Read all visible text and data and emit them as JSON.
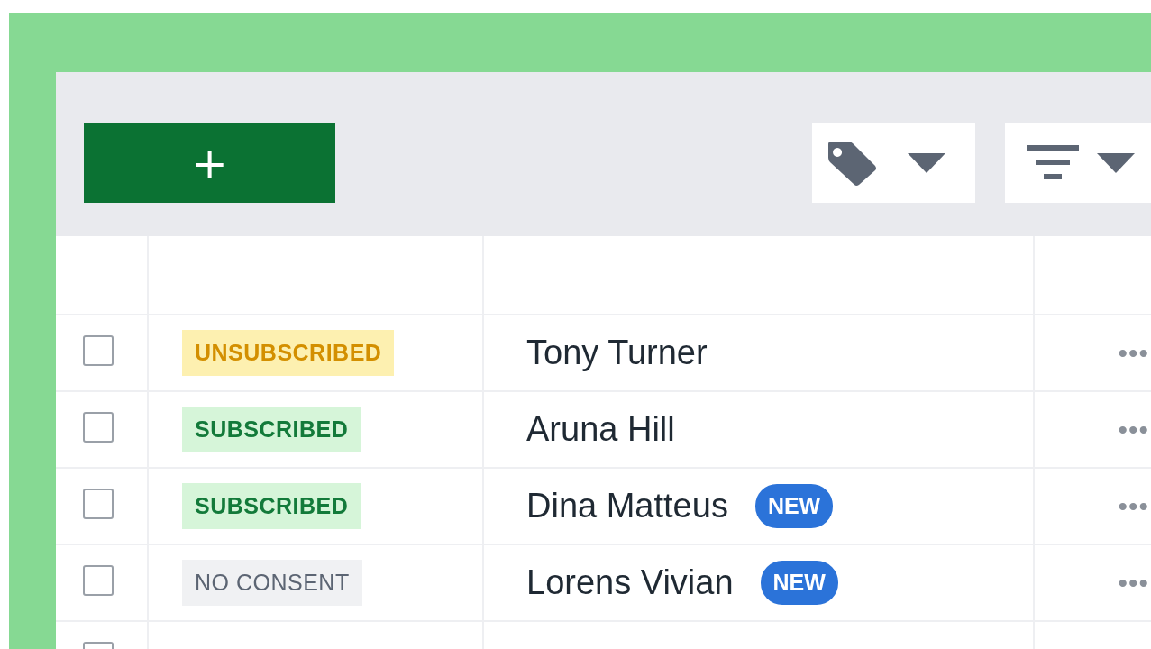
{
  "toolbar": {
    "add_button": "+"
  },
  "rows": [
    {
      "checked": false,
      "status": {
        "label": "UNSUBSCRIBED",
        "kind": "unsubscribed"
      },
      "name": "Tony Turner",
      "actions": "•••"
    },
    {
      "checked": false,
      "status": {
        "label": "SUBSCRIBED",
        "kind": "subscribed"
      },
      "name": "Aruna Hill",
      "actions": "•••"
    },
    {
      "checked": false,
      "status": {
        "label": "SUBSCRIBED",
        "kind": "subscribed"
      },
      "name": "Dina Matteus",
      "badge": "NEW",
      "actions": "•••"
    },
    {
      "checked": false,
      "status": {
        "label": "NO CONSENT",
        "kind": "no_consent"
      },
      "name": "Lorens Vivian",
      "badge": "NEW",
      "actions": "•••"
    },
    {
      "checked": false
    }
  ]
}
